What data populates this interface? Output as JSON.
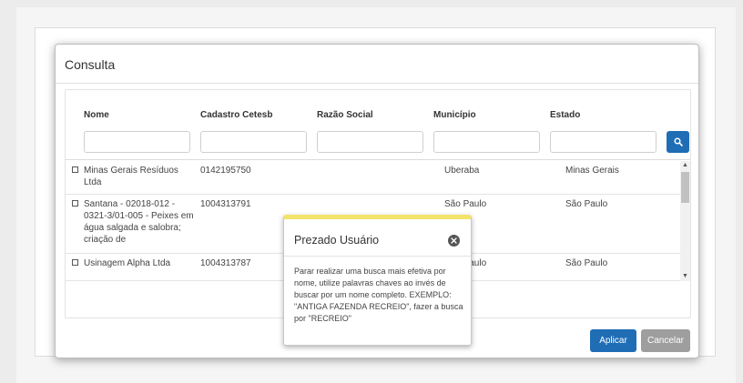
{
  "modal": {
    "title": "Consulta",
    "columns": [
      "Nome",
      "Cadastro Cetesb",
      "Razão Social",
      "Município",
      "Estado"
    ],
    "rows": [
      {
        "nome": "Minas Gerais Resíduos Ltda",
        "cadastro": "0142195750",
        "razao": "",
        "municipio": "Uberaba",
        "estado": "Minas Gerais"
      },
      {
        "nome": "Santana - 02018-012 - 0321-3/01-005 - Peixes em água salgada e salobra; criação de",
        "cadastro": "1004313791",
        "razao": "",
        "municipio": "São Paulo",
        "estado": "São Paulo"
      },
      {
        "nome": "Usinagem Alpha Ltda",
        "cadastro": "1004313787",
        "razao": "",
        "municipio": "São Paulo",
        "estado": "São Paulo"
      }
    ],
    "apply_label": "Aplicar",
    "cancel_label": "Cancelar"
  },
  "popover": {
    "title": "Prezado Usuário",
    "body": "Parar realizar uma busca mais efetiva por nome, utilize palavras chaves ao invés de buscar por um nome completo. EXEMPLO: \"ANTIGA FAZENDA RECREIO\", fazer a busca por \"RECREIO\""
  },
  "colors": {
    "primary": "#1f6db5",
    "cancel": "#9e9e9e",
    "popover_accent": "#f4e36b"
  },
  "icons": {
    "search": "search-icon",
    "close": "close-circle-icon",
    "scroll_up": "scroll-up-icon",
    "scroll_down": "scroll-down-icon"
  }
}
